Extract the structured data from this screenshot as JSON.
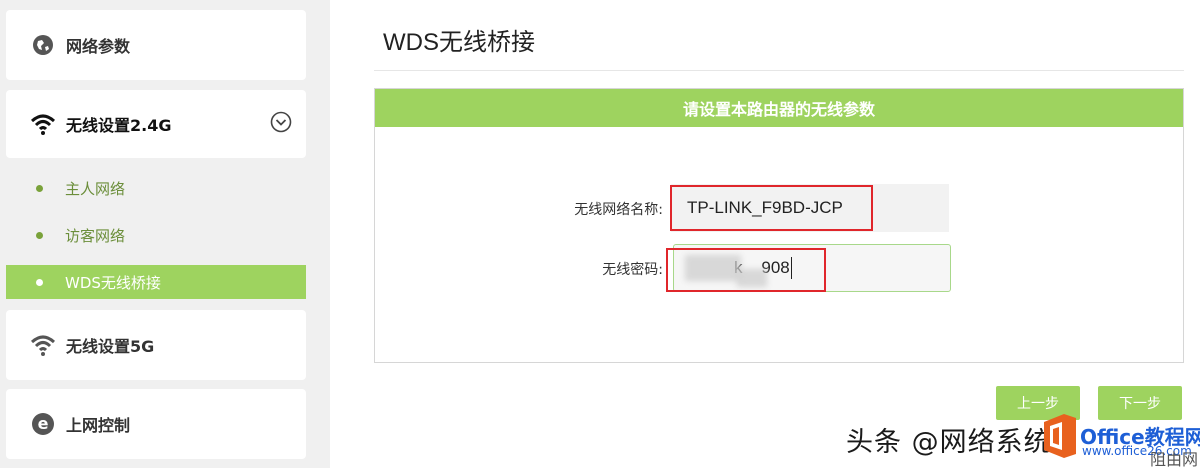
{
  "sidebar": {
    "network_params": "网络参数",
    "wireless_24": "无线设置2.4G",
    "sub_items": [
      "主人网络",
      "访客网络",
      "WDS无线桥接"
    ],
    "wireless_5": "无线设置5G",
    "internet_control": "上网控制"
  },
  "main": {
    "title": "WDS无线桥接",
    "panel_header": "请设置本路由器的无线参数",
    "ssid_label": "无线网络名称:",
    "ssid_value": "TP-LINK_F9BD-JCP",
    "password_label": "无线密码:",
    "password_visible_fragment": "k    908",
    "prev_button": "上一步",
    "next_button": "下一步"
  },
  "watermark": {
    "text": "头条 @网络系统",
    "brand": "Office教程网",
    "url": "www.office26.com",
    "tail": "阻由网"
  },
  "colors": {
    "accent_green": "#9ed35f",
    "highlight_red": "#e0262b",
    "sidebar_bg": "#f0f0f0"
  }
}
